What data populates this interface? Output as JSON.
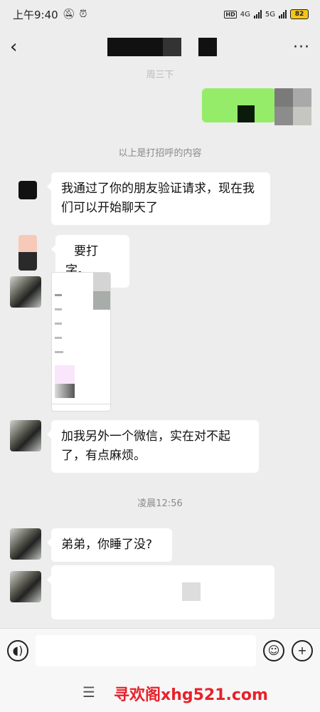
{
  "status_bar": {
    "time": "上午9:40",
    "mute_icon": "bell-off-icon",
    "alarm_icon": "alarm-icon",
    "hd_badge": "HD",
    "net1": "4G",
    "net2": "5G",
    "battery": "82"
  },
  "nav": {
    "back_icon": "chevron-left-icon",
    "more_label": "···"
  },
  "chat": {
    "date_top": "周三下",
    "system_greeting": "以上是打招呼的内容",
    "msg_verify": "我通过了你的朋友验证请求，现在我们可以开始聊天了",
    "msg_typing": "要打字。",
    "msg_add_wechat": "加我另外一个微信，实在对不起了，有点麻烦。",
    "timestamp": "凌晨12:56",
    "msg_sleep": "弟弟，你睡了没?"
  },
  "input_bar": {
    "voice_icon": "voice-icon",
    "emoji_icon": "emoji-icon",
    "plus_icon": "plus-icon",
    "placeholder": ""
  },
  "bottom": {
    "menu_icon": "menu-icon",
    "watermark": "寻欢阁xhg521.com"
  }
}
